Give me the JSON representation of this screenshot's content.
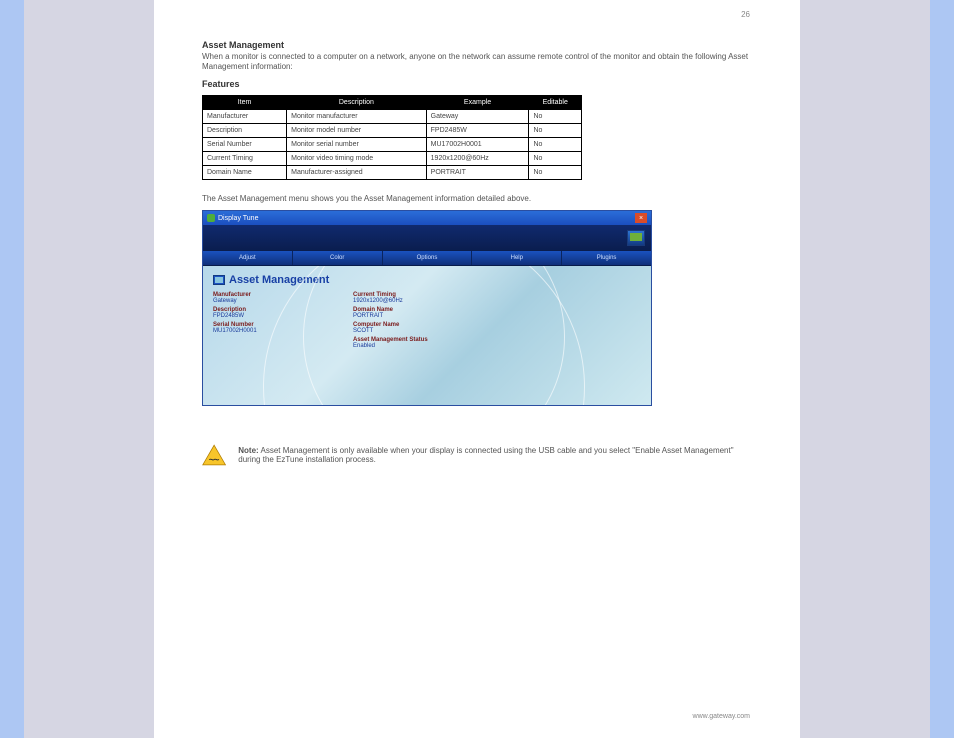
{
  "page_number_top": "26",
  "intro": {
    "heading": "Asset Management",
    "p1": "When a monitor is connected to a computer on a network, anyone on the network can assume remote control of the monitor and obtain the following Asset Management information:",
    "p2": "The Asset Management menu shows you the Asset Management information detailed above."
  },
  "features_heading": "Features",
  "table": {
    "headers": [
      "Item",
      "Description",
      "Example",
      "Editable"
    ],
    "rows": [
      [
        "Manufacturer",
        "Monitor manufacturer",
        "Gateway",
        "No"
      ],
      [
        "Description",
        "Monitor model number",
        "FPD2485W",
        "No"
      ],
      [
        "Serial Number",
        "Monitor serial number",
        "MU17002H0001",
        "No"
      ],
      [
        "Current Timing",
        "Monitor video timing mode",
        "1920x1200@60Hz",
        "No"
      ],
      [
        "Domain Name",
        "Manufacturer-assigned",
        "PORTRAIT",
        "No"
      ]
    ]
  },
  "app": {
    "title": "Display Tune",
    "tabs": [
      "Adjust",
      "Color",
      "Options",
      "Help",
      "Plugins"
    ],
    "panel_title": "Asset Management",
    "left_fields": [
      {
        "label": "Manufacturer",
        "value": "Gateway"
      },
      {
        "label": "Description",
        "value": "FPD2485W"
      },
      {
        "label": "Serial Number",
        "value": "MU17002H0001"
      }
    ],
    "right_fields": [
      {
        "label": "Current Timing",
        "value": "1920x1200@60Hz"
      },
      {
        "label": "Domain Name",
        "value": "PORTRAIT"
      },
      {
        "label": "Computer Name",
        "value": "SCOTT"
      },
      {
        "label": "Asset Management Status",
        "value": "Enabled"
      }
    ]
  },
  "note": {
    "lead": "Note:",
    "body": "Asset Management is only available when your display is connected using the USB cable and you select \"Enable Asset Management\" during the EzTune installation process."
  },
  "footer": "www.gateway.com"
}
